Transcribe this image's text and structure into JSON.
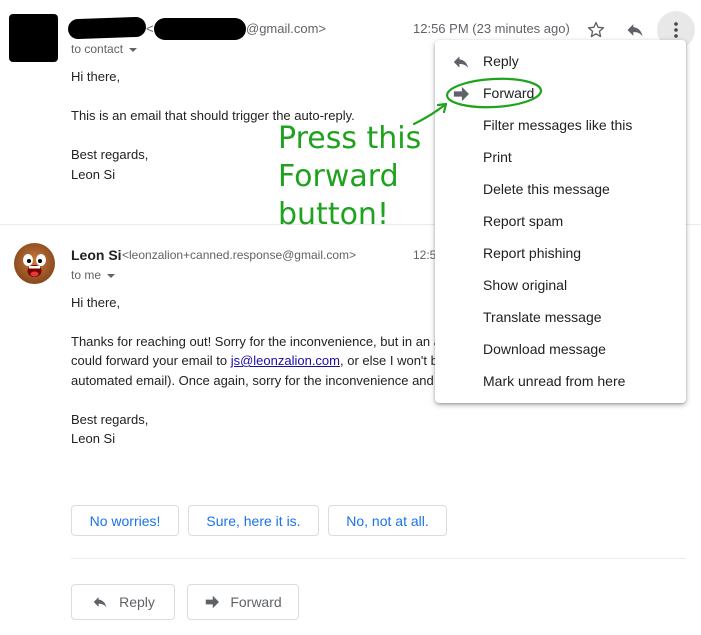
{
  "message1": {
    "sender_bracket": "<",
    "email_domain": "@gmail.com>",
    "time": "12:56 PM (23 minutes ago)",
    "recipient": "to contact",
    "body": [
      "Hi there,",
      "This is an email that should trigger the auto-reply.",
      "Best regards,",
      "Leon Si"
    ]
  },
  "message2": {
    "sender_name": "Leon Si",
    "sender_email": "<leonzalion+canned.response@gmail.com>",
    "time": "12:5",
    "recipient": "to me",
    "greeting": "Hi there,",
    "line1": "Thanks for reaching out! Sorry for the inconvenience, but in an a",
    "line2_before": "could forward your email to ",
    "line2_link": "js@leonzalion.com",
    "line2_after": ", or else I won't b",
    "line3": "automated email). Once again, sorry for the inconvenience and",
    "closing": "Best regards,",
    "signature": "Leon Si"
  },
  "smart_replies": [
    "No worries!",
    "Sure, here it is.",
    "No, not at all."
  ],
  "actions": {
    "reply": "Reply",
    "forward": "Forward"
  },
  "menu": {
    "items": [
      "Reply",
      "Forward",
      "Filter messages like this",
      "Print",
      "Delete this message",
      "Report spam",
      "Report phishing",
      "Show original",
      "Translate message",
      "Download message",
      "Mark unread from here"
    ]
  },
  "annotation": {
    "lines": [
      "Press this",
      "Forward",
      "button!"
    ]
  },
  "colors": {
    "annotation": "#1fa31f",
    "link": "#1a0dab",
    "chip_text": "#1a73e8"
  },
  "icons": [
    "star-icon",
    "reply-icon",
    "more-vert-icon",
    "forward-icon"
  ]
}
